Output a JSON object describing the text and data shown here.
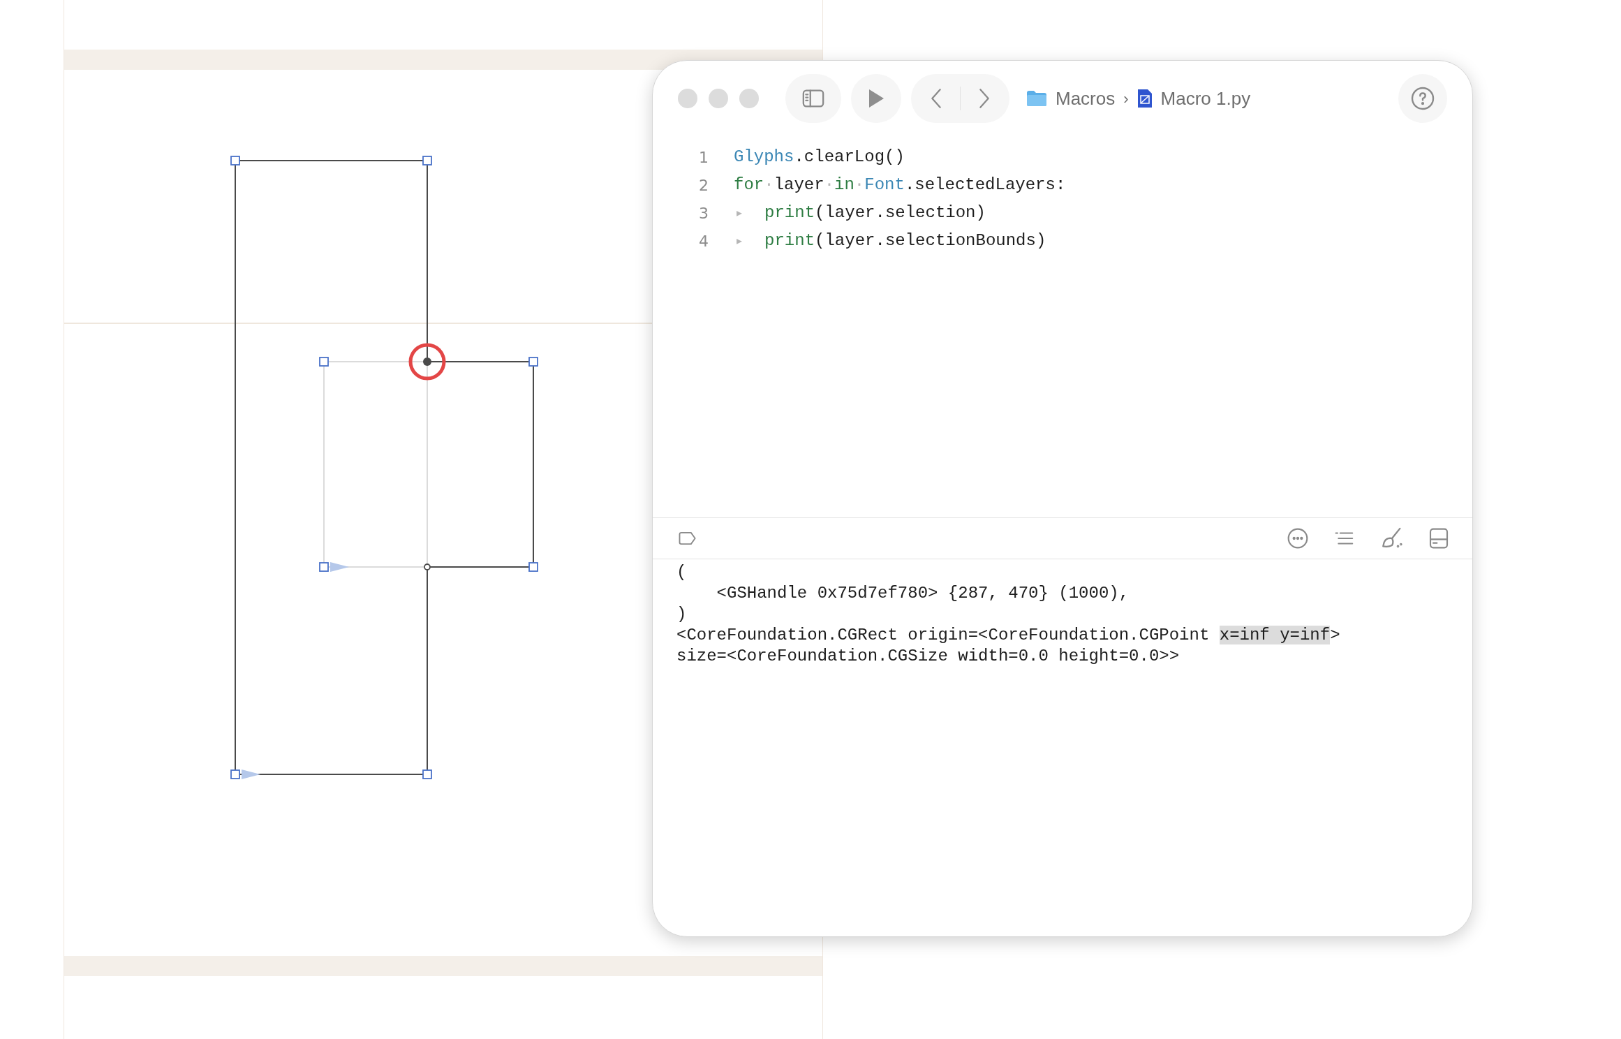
{
  "toolbar": {
    "breadcrumb": [
      {
        "label": "Macros",
        "kind": "folder"
      },
      {
        "label": "Macro 1.py",
        "kind": "file"
      }
    ],
    "separator": "›"
  },
  "editor": {
    "lines": [
      {
        "number": "1",
        "tokens": [
          {
            "text": "Glyphs",
            "kind": "builtin"
          },
          {
            "text": ".clearLog()",
            "kind": "plain"
          }
        ]
      },
      {
        "number": "2",
        "tokens": [
          {
            "text": "for",
            "kind": "keyword"
          },
          {
            "text": "·",
            "kind": "whitespace"
          },
          {
            "text": "layer",
            "kind": "plain"
          },
          {
            "text": "·",
            "kind": "whitespace"
          },
          {
            "text": "in",
            "kind": "keyword"
          },
          {
            "text": "·",
            "kind": "whitespace"
          },
          {
            "text": "Font",
            "kind": "builtin"
          },
          {
            "text": ".selectedLayers:",
            "kind": "plain"
          }
        ]
      },
      {
        "number": "3",
        "tokens": [
          {
            "text": "▸",
            "kind": "tab"
          },
          {
            "text": "print",
            "kind": "keyword"
          },
          {
            "text": "(layer.selection)",
            "kind": "plain"
          }
        ]
      },
      {
        "number": "4",
        "tokens": [
          {
            "text": "▸",
            "kind": "tab"
          },
          {
            "text": "print",
            "kind": "keyword"
          },
          {
            "text": "(layer.selectionBounds)",
            "kind": "plain"
          }
        ]
      }
    ]
  },
  "console": {
    "lines": [
      {
        "segments": [
          {
            "text": "(",
            "highlighted": false
          }
        ]
      },
      {
        "segments": [
          {
            "text": "    <GSHandle 0x75d7ef780> {287, 470} (1000),",
            "highlighted": false
          }
        ]
      },
      {
        "segments": [
          {
            "text": ")",
            "highlighted": false
          }
        ]
      },
      {
        "segments": [
          {
            "text": "<CoreFoundation.CGRect origin=<CoreFoundation.CGPoint ",
            "highlighted": false
          },
          {
            "text": "x=inf y=inf",
            "highlighted": true
          },
          {
            "text": ">",
            "highlighted": false
          }
        ]
      },
      {
        "segments": [
          {
            "text": "size=<CoreFoundation.CGSize width=0.0 height=0.0>>",
            "highlighted": false
          }
        ]
      }
    ]
  }
}
